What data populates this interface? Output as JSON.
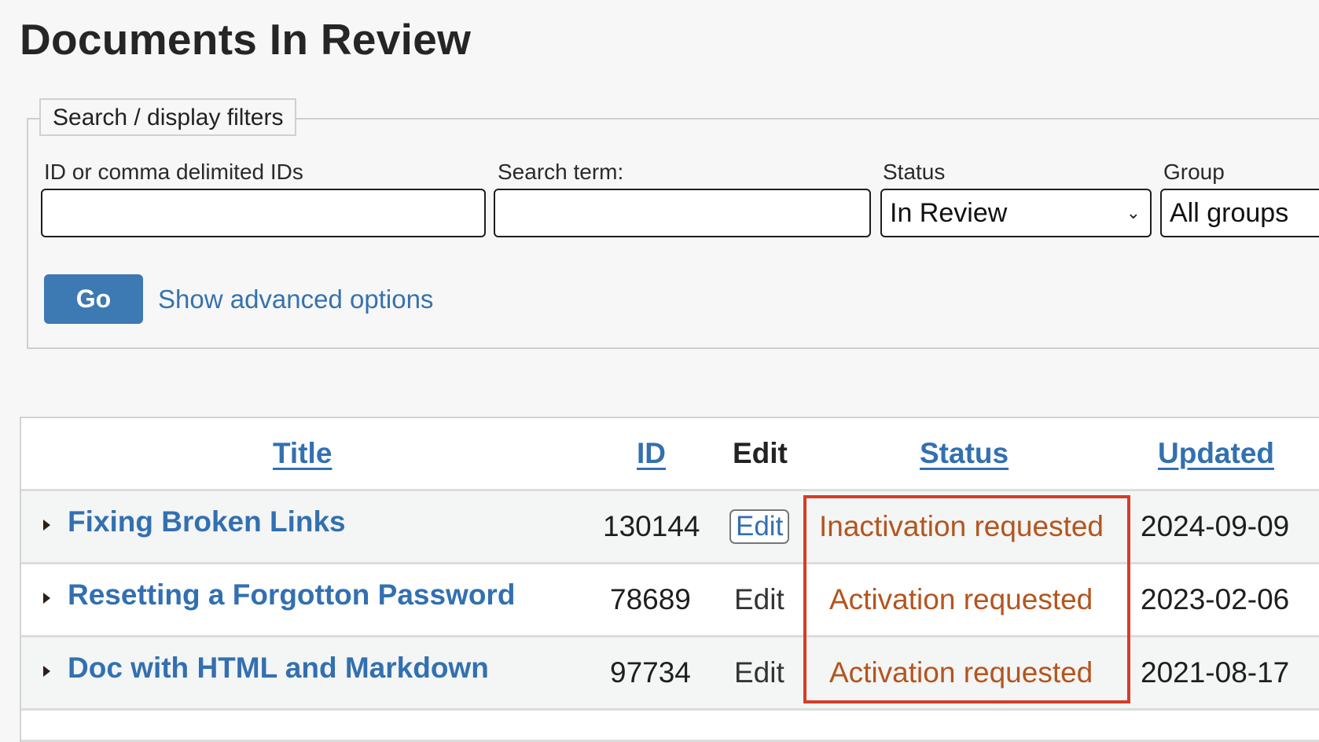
{
  "page": {
    "title": "Documents In Review"
  },
  "filters": {
    "legend": "Search / display filters",
    "ids": {
      "label": "ID or comma delimited IDs",
      "value": "",
      "placeholder": ""
    },
    "search": {
      "label": "Search term:",
      "value": "",
      "placeholder": ""
    },
    "status": {
      "label": "Status",
      "selected": "In Review"
    },
    "group": {
      "label": "Group",
      "selected": "All groups"
    },
    "go_label": "Go",
    "advanced_label": "Show advanced options"
  },
  "table": {
    "columns": {
      "title": "Title",
      "id": "ID",
      "edit": "Edit",
      "status": "Status",
      "updated": "Updated"
    },
    "rows": [
      {
        "title": "Fixing Broken Links",
        "id": "130144",
        "edit": "Edit",
        "status": "Inactivation requested",
        "updated": "2024-09-09"
      },
      {
        "title": "Resetting a Forgotton Password",
        "id": "78689",
        "edit": "Edit",
        "status": "Activation requested",
        "updated": "2023-02-06"
      },
      {
        "title": "Doc with HTML and Markdown",
        "id": "97734",
        "edit": "Edit",
        "status": "Activation requested",
        "updated": "2021-08-17"
      }
    ]
  },
  "colors": {
    "link": "#3270b0",
    "button": "#3d79b3",
    "status": "#b3551e",
    "highlight": "#d43d27"
  }
}
